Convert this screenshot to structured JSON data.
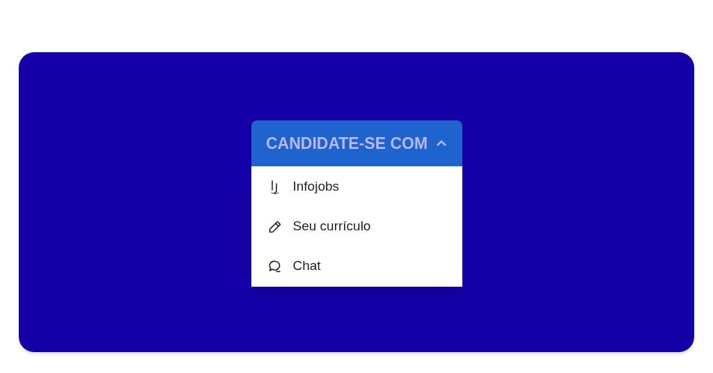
{
  "dropdown": {
    "label": "CANDIDATE-SE COM",
    "expanded": true,
    "items": [
      {
        "kind": "infojobs",
        "label": "Infojobs"
      },
      {
        "kind": "pencil",
        "label": "Seu currículo"
      },
      {
        "kind": "chat",
        "label": "Chat"
      }
    ]
  }
}
